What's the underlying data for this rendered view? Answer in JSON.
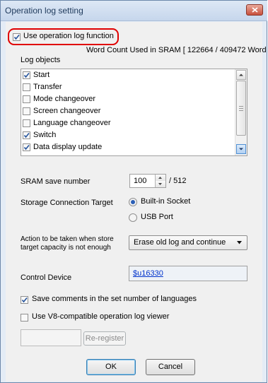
{
  "window": {
    "title": "Operation log setting",
    "close_icon": "close-icon",
    "accent_red": "#e00000",
    "link_color": "#0033cc"
  },
  "use_function": {
    "label": "Use operation log function",
    "checked": true
  },
  "word_count": "Word Count Used in SRAM  [ 122664 / 409472 Word ]",
  "log_objects": {
    "heading": "Log objects",
    "items": [
      {
        "label": "Start",
        "checked": true
      },
      {
        "label": "Transfer",
        "checked": false
      },
      {
        "label": "Mode changeover",
        "checked": false
      },
      {
        "label": "Screen changeover",
        "checked": false
      },
      {
        "label": "Language changeover",
        "checked": false
      },
      {
        "label": "Switch",
        "checked": true
      },
      {
        "label": "Data display update",
        "checked": true
      }
    ]
  },
  "sram": {
    "label": "SRAM save number",
    "value": "100",
    "max": "/ 512"
  },
  "storage": {
    "label": "Storage Connection Target",
    "options": [
      {
        "label": "Built-in Socket",
        "selected": true
      },
      {
        "label": "USB Port",
        "selected": false
      }
    ]
  },
  "action": {
    "label_line1": "Action to be taken when store",
    "label_line2": "target capacity is not enough",
    "selected": "Erase old log and continue"
  },
  "control": {
    "label": "Control Device",
    "value": "$u16330"
  },
  "save_comments": {
    "label": "Save comments in the set number of languages",
    "checked": true
  },
  "v8_viewer": {
    "label": "Use V8-compatible operation log viewer",
    "checked": false
  },
  "reregister": {
    "field_value": "",
    "button_label": "Re-register"
  },
  "buttons": {
    "ok": "OK",
    "cancel": "Cancel"
  }
}
